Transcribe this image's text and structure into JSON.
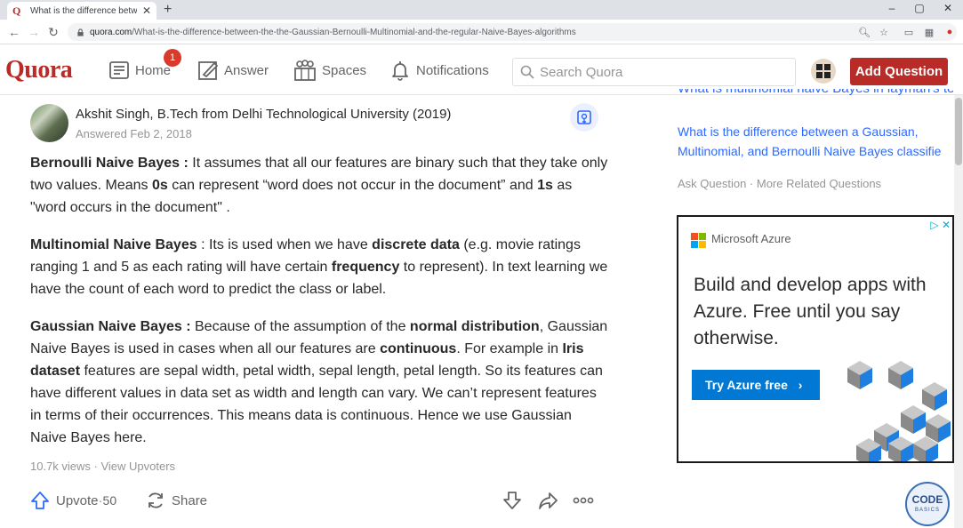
{
  "browser": {
    "tab_title": "What is the difference between t",
    "tab_favicon": "Q",
    "url_host": "quora.com",
    "url_path": "/What-is-the-difference-between-the-the-Gaussian-Bernoulli-Multinomial-and-the-regular-Naive-Bayes-algorithms"
  },
  "header": {
    "logo": "Quora",
    "nav": {
      "home": "Home",
      "answer": "Answer",
      "spaces": "Spaces",
      "notifications": "Notifications"
    },
    "home_badge": "1",
    "search_placeholder": "Search Quora",
    "add_question": "Add Question",
    "brand_color": "#b92b27"
  },
  "answer": {
    "author": "Akshit Singh, B.Tech from Delhi Technological University (2019)",
    "answered": "Answered Feb 2, 2018",
    "paragraphs": {
      "p1": {
        "b1": "Bernoulli Naive Bayes :",
        "t1": " It assumes that all our features are binary such that they take only two values. Means ",
        "b2": "0s",
        "t2": " can represent “word does not occur in the document” and ",
        "b3": "1s",
        "t3": " as \"word occurs in the document\" ."
      },
      "p2": {
        "b1": "Multinomial Naive Bayes",
        "t1": " : Its is used when we have ",
        "b2": "discrete data",
        "t2": " (e.g. movie ratings ranging 1 and 5 as each rating will have certain ",
        "b3": "frequency",
        "t3": " to represent). In text learning we have the count of each word to predict the class or label."
      },
      "p3": {
        "b1": "Gaussian Naive Bayes :",
        "t1": " Because of the assumption of the ",
        "b2": "normal distribution",
        "t2": ", Gaussian Naive Bayes is used in cases when all our features are ",
        "b3": "continuous",
        "t3": ". For example in ",
        "b4": "Iris dataset",
        "t4": " features are sepal width, petal width, sepal length, petal length. So its features can have different values in data set as width and length can vary. We can’t represent features in terms of their occurrences. This means data is continuous. Hence we use Gaussian Naive Bayes here."
      }
    },
    "views": "10.7k views · View Upvoters",
    "upvote_label": "Upvote",
    "upvote_sep": " · ",
    "upvote_count": "50",
    "share_label": "Share"
  },
  "sidebar": {
    "related_cut": "What is multinomial naive Bayes in layman's ter",
    "related_link": "What is the difference between a Gaussian, Multinomial, and Bernoulli Naive Bayes classifie",
    "more_links": "Ask Question · More Related Questions"
  },
  "ad": {
    "brand": "Microsoft Azure",
    "headline": "Build and develop apps with Azure. Free until you say otherwise.",
    "cta": "Try Azure free",
    "cta_color": "#0078d4"
  },
  "watermark": {
    "top": "CODE",
    "bottom": "BASICS"
  }
}
